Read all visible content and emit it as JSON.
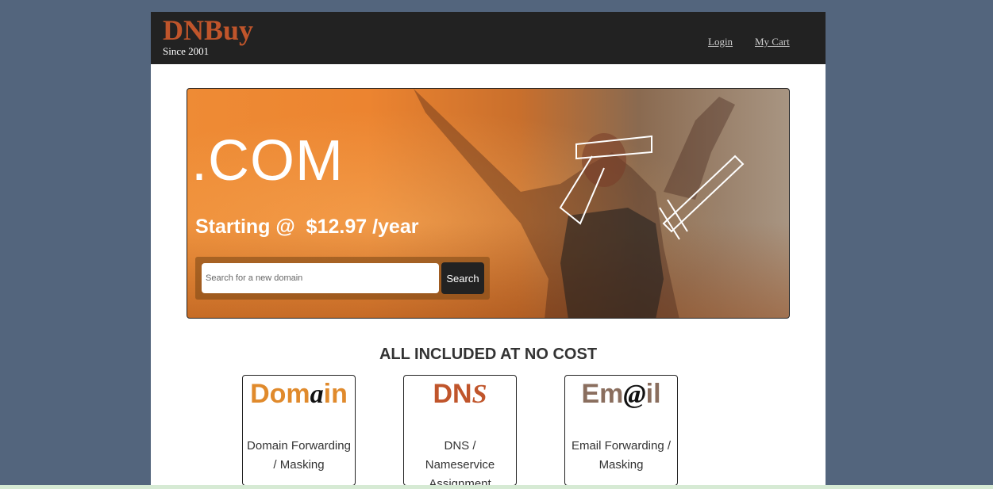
{
  "header": {
    "logo": "DNBuy",
    "tagline": "Since 2001",
    "nav": {
      "login": "Login",
      "cart": "My Cart"
    },
    "colors": {
      "logo": "#c0552b",
      "bar": "#222222"
    }
  },
  "hero": {
    "title": ".COM",
    "price": "Starting @  $12.97 /year",
    "search": {
      "placeholder": "Search for a new domain",
      "button": "Search"
    }
  },
  "features": {
    "title": "ALL INCLUDED AT NO COST",
    "cards": [
      {
        "logo_pre": "Dom",
        "logo_mid": "a",
        "logo_post": "in",
        "label": "Domain Forwarding / Masking"
      },
      {
        "logo_pre": "DN",
        "logo_mid": "S",
        "logo_post": "",
        "label": "DNS / Nameservice Assignment"
      },
      {
        "logo_pre": "Em",
        "logo_mid": "@",
        "logo_post": "il",
        "label": "Email Forwarding / Masking"
      }
    ]
  },
  "colors": {
    "background": "#53657d",
    "hero_orange": "#ee8b35"
  }
}
